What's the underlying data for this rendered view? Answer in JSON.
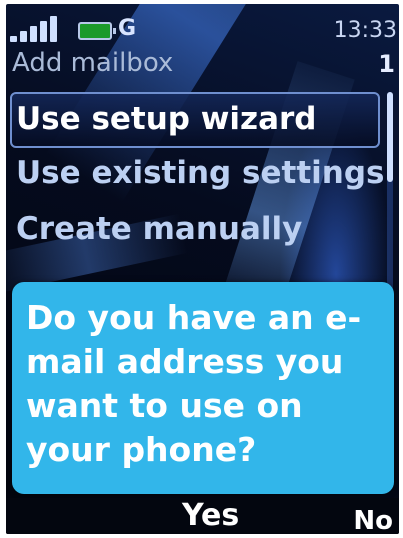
{
  "status_bar": {
    "signal_icon": "signal-bars-icon",
    "battery_icon": "battery-icon",
    "network_type": "G",
    "clock": "13:33"
  },
  "header": {
    "title": "Add mailbox",
    "page_indicator": "1"
  },
  "menu": {
    "items": [
      {
        "label": "Use setup wizard",
        "selected": true
      },
      {
        "label": "Use existing settings",
        "selected": false
      },
      {
        "label": "Create manually",
        "selected": false
      }
    ]
  },
  "dialog": {
    "text": "Do you have an e-mail address you want to use on your phone?"
  },
  "softkeys": {
    "middle": "Yes",
    "right": "No"
  },
  "colors": {
    "dialog_background": "#32b6ea",
    "screen_background": "#050b1e",
    "selection_border": "#6f8fcf"
  }
}
